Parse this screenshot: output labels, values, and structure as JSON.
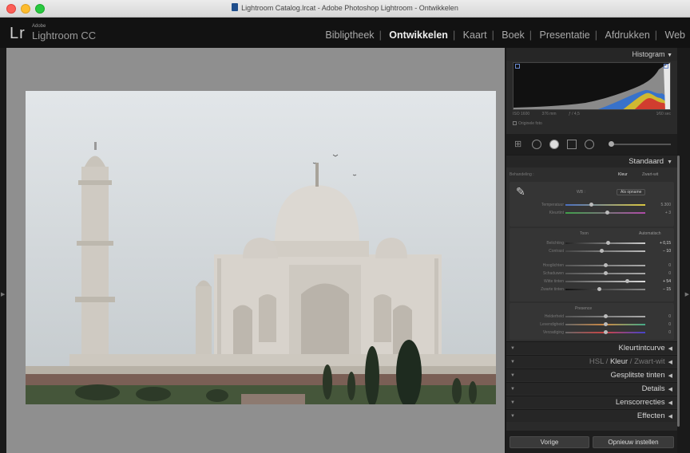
{
  "window": {
    "title": "Lightroom Catalog.lrcat - Adobe Photoshop Lightroom - Ontwikkelen"
  },
  "app": {
    "logo": "Lr",
    "vendor": "Adobe",
    "name": "Lightroom CC"
  },
  "modules": [
    "Bibliotheek",
    "Ontwikkelen",
    "Kaart",
    "Boek",
    "Presentatie",
    "Afdrukken",
    "Web"
  ],
  "active_module": "Ontwikkelen",
  "histogram": {
    "title": "Histogram",
    "iso": "ISO 1600",
    "focal": "376 mm",
    "aperture": "ƒ / 4,5",
    "shutter": "1⁄60 sec",
    "original_label": "Originele foto"
  },
  "basic": {
    "preset": "Standaard",
    "treatment_label": "Behandeling :",
    "treatment_color": "Kleur",
    "treatment_bw": "Zwart-wit",
    "wb_label": "WB :",
    "wb_value": "Als opname",
    "temp_label": "Temperatuur",
    "temp_value": "5.300",
    "tint_label": "Kleurtint",
    "tint_value": "+ 3",
    "tone_label": "Toon",
    "auto_label": "Automatisch",
    "exposure_label": "Belichting",
    "exposure_value": "+ 0,15",
    "contrast_label": "Contrast",
    "contrast_value": "− 10",
    "highlights_label": "Hooglichten",
    "highlights_value": "0",
    "shadows_label": "Schaduwen",
    "shadows_value": "0",
    "whites_label": "Witte tinten",
    "whites_value": "+ 54",
    "blacks_label": "Zwarte tinten",
    "blacks_value": "− 15",
    "presence_label": "Presence",
    "clarity_label": "Helderheid",
    "clarity_value": "0",
    "vibrance_label": "Levendigheid",
    "vibrance_value": "0",
    "saturation_label": "Verzadiging",
    "saturation_value": "0"
  },
  "sections": {
    "tone_curve": "Kleurtintcurve",
    "hsl": "HSL",
    "color": "Kleur",
    "bw": "Zwart-wit",
    "split": "Gesplitste tinten",
    "details": "Details",
    "lens": "Lenscorrecties",
    "effects": "Effecten"
  },
  "buttons": {
    "previous": "Vorige",
    "reset": "Opnieuw instellen"
  },
  "slider_positions": {
    "temperature": 0.32,
    "tint": 0.52,
    "exposure": 0.53,
    "contrast": 0.45,
    "highlights": 0.5,
    "shadows": 0.5,
    "whites": 0.77,
    "blacks": 0.42,
    "clarity": 0.5,
    "vibrance": 0.5,
    "saturation": 0.5
  }
}
